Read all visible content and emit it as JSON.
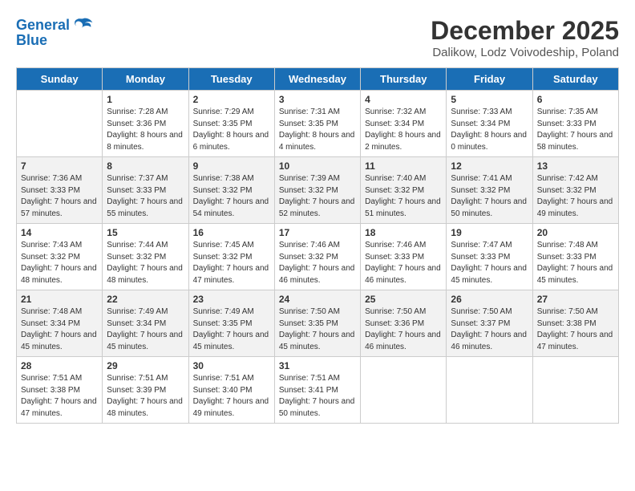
{
  "header": {
    "logo_line1": "General",
    "logo_line2": "Blue",
    "month": "December 2025",
    "location": "Dalikow, Lodz Voivodeship, Poland"
  },
  "days_of_week": [
    "Sunday",
    "Monday",
    "Tuesday",
    "Wednesday",
    "Thursday",
    "Friday",
    "Saturday"
  ],
  "weeks": [
    [
      {
        "day": "",
        "sunrise": "",
        "sunset": "",
        "daylight": ""
      },
      {
        "day": "1",
        "sunrise": "Sunrise: 7:28 AM",
        "sunset": "Sunset: 3:36 PM",
        "daylight": "Daylight: 8 hours and 8 minutes."
      },
      {
        "day": "2",
        "sunrise": "Sunrise: 7:29 AM",
        "sunset": "Sunset: 3:35 PM",
        "daylight": "Daylight: 8 hours and 6 minutes."
      },
      {
        "day": "3",
        "sunrise": "Sunrise: 7:31 AM",
        "sunset": "Sunset: 3:35 PM",
        "daylight": "Daylight: 8 hours and 4 minutes."
      },
      {
        "day": "4",
        "sunrise": "Sunrise: 7:32 AM",
        "sunset": "Sunset: 3:34 PM",
        "daylight": "Daylight: 8 hours and 2 minutes."
      },
      {
        "day": "5",
        "sunrise": "Sunrise: 7:33 AM",
        "sunset": "Sunset: 3:34 PM",
        "daylight": "Daylight: 8 hours and 0 minutes."
      },
      {
        "day": "6",
        "sunrise": "Sunrise: 7:35 AM",
        "sunset": "Sunset: 3:33 PM",
        "daylight": "Daylight: 7 hours and 58 minutes."
      }
    ],
    [
      {
        "day": "7",
        "sunrise": "Sunrise: 7:36 AM",
        "sunset": "Sunset: 3:33 PM",
        "daylight": "Daylight: 7 hours and 57 minutes."
      },
      {
        "day": "8",
        "sunrise": "Sunrise: 7:37 AM",
        "sunset": "Sunset: 3:33 PM",
        "daylight": "Daylight: 7 hours and 55 minutes."
      },
      {
        "day": "9",
        "sunrise": "Sunrise: 7:38 AM",
        "sunset": "Sunset: 3:32 PM",
        "daylight": "Daylight: 7 hours and 54 minutes."
      },
      {
        "day": "10",
        "sunrise": "Sunrise: 7:39 AM",
        "sunset": "Sunset: 3:32 PM",
        "daylight": "Daylight: 7 hours and 52 minutes."
      },
      {
        "day": "11",
        "sunrise": "Sunrise: 7:40 AM",
        "sunset": "Sunset: 3:32 PM",
        "daylight": "Daylight: 7 hours and 51 minutes."
      },
      {
        "day": "12",
        "sunrise": "Sunrise: 7:41 AM",
        "sunset": "Sunset: 3:32 PM",
        "daylight": "Daylight: 7 hours and 50 minutes."
      },
      {
        "day": "13",
        "sunrise": "Sunrise: 7:42 AM",
        "sunset": "Sunset: 3:32 PM",
        "daylight": "Daylight: 7 hours and 49 minutes."
      }
    ],
    [
      {
        "day": "14",
        "sunrise": "Sunrise: 7:43 AM",
        "sunset": "Sunset: 3:32 PM",
        "daylight": "Daylight: 7 hours and 48 minutes."
      },
      {
        "day": "15",
        "sunrise": "Sunrise: 7:44 AM",
        "sunset": "Sunset: 3:32 PM",
        "daylight": "Daylight: 7 hours and 48 minutes."
      },
      {
        "day": "16",
        "sunrise": "Sunrise: 7:45 AM",
        "sunset": "Sunset: 3:32 PM",
        "daylight": "Daylight: 7 hours and 47 minutes."
      },
      {
        "day": "17",
        "sunrise": "Sunrise: 7:46 AM",
        "sunset": "Sunset: 3:32 PM",
        "daylight": "Daylight: 7 hours and 46 minutes."
      },
      {
        "day": "18",
        "sunrise": "Sunrise: 7:46 AM",
        "sunset": "Sunset: 3:33 PM",
        "daylight": "Daylight: 7 hours and 46 minutes."
      },
      {
        "day": "19",
        "sunrise": "Sunrise: 7:47 AM",
        "sunset": "Sunset: 3:33 PM",
        "daylight": "Daylight: 7 hours and 45 minutes."
      },
      {
        "day": "20",
        "sunrise": "Sunrise: 7:48 AM",
        "sunset": "Sunset: 3:33 PM",
        "daylight": "Daylight: 7 hours and 45 minutes."
      }
    ],
    [
      {
        "day": "21",
        "sunrise": "Sunrise: 7:48 AM",
        "sunset": "Sunset: 3:34 PM",
        "daylight": "Daylight: 7 hours and 45 minutes."
      },
      {
        "day": "22",
        "sunrise": "Sunrise: 7:49 AM",
        "sunset": "Sunset: 3:34 PM",
        "daylight": "Daylight: 7 hours and 45 minutes."
      },
      {
        "day": "23",
        "sunrise": "Sunrise: 7:49 AM",
        "sunset": "Sunset: 3:35 PM",
        "daylight": "Daylight: 7 hours and 45 minutes."
      },
      {
        "day": "24",
        "sunrise": "Sunrise: 7:50 AM",
        "sunset": "Sunset: 3:35 PM",
        "daylight": "Daylight: 7 hours and 45 minutes."
      },
      {
        "day": "25",
        "sunrise": "Sunrise: 7:50 AM",
        "sunset": "Sunset: 3:36 PM",
        "daylight": "Daylight: 7 hours and 46 minutes."
      },
      {
        "day": "26",
        "sunrise": "Sunrise: 7:50 AM",
        "sunset": "Sunset: 3:37 PM",
        "daylight": "Daylight: 7 hours and 46 minutes."
      },
      {
        "day": "27",
        "sunrise": "Sunrise: 7:50 AM",
        "sunset": "Sunset: 3:38 PM",
        "daylight": "Daylight: 7 hours and 47 minutes."
      }
    ],
    [
      {
        "day": "28",
        "sunrise": "Sunrise: 7:51 AM",
        "sunset": "Sunset: 3:38 PM",
        "daylight": "Daylight: 7 hours and 47 minutes."
      },
      {
        "day": "29",
        "sunrise": "Sunrise: 7:51 AM",
        "sunset": "Sunset: 3:39 PM",
        "daylight": "Daylight: 7 hours and 48 minutes."
      },
      {
        "day": "30",
        "sunrise": "Sunrise: 7:51 AM",
        "sunset": "Sunset: 3:40 PM",
        "daylight": "Daylight: 7 hours and 49 minutes."
      },
      {
        "day": "31",
        "sunrise": "Sunrise: 7:51 AM",
        "sunset": "Sunset: 3:41 PM",
        "daylight": "Daylight: 7 hours and 50 minutes."
      },
      {
        "day": "",
        "sunrise": "",
        "sunset": "",
        "daylight": ""
      },
      {
        "day": "",
        "sunrise": "",
        "sunset": "",
        "daylight": ""
      },
      {
        "day": "",
        "sunrise": "",
        "sunset": "",
        "daylight": ""
      }
    ]
  ]
}
